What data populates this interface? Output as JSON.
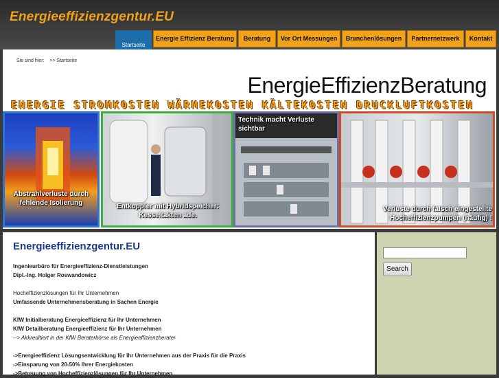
{
  "site": {
    "logo": "Energieeffizienzgentur.EU"
  },
  "nav": {
    "home": "Startseite",
    "items": [
      "Energie Effizienz Beratung",
      "Beratung",
      "Vor Ort Messungen",
      "Branchenlösungen",
      "Partnernetzwerk",
      "Kontakt"
    ]
  },
  "breadcrumb": {
    "label": "Sie sind hier:",
    "path": ">> Startseite"
  },
  "banner": {
    "title": "EnergieEffizienzBeratung",
    "subtitle": "ENERGIE STROMKOSTEN WÄRMEKOSTEN KÄLTEKOSTEN DRUCKLUFTKOSTEN",
    "panels": [
      {
        "caption": "Abstrahlverluste durch fehlende Isolierung"
      },
      {
        "caption": "Entkoppler mit Hybridspeicher: Kesseltakten ade."
      },
      {
        "caption": "Technik macht Verluste sichtbar"
      },
      {
        "caption": "Verluste durch falsch eingestellte Hocheffizienzpumpen (häufig) !"
      }
    ]
  },
  "content": {
    "title": "Energieeffizienzgentur.EU",
    "line1": "Ingenieurbüro für Energieeffizienz-Dienstleistungen",
    "line2": "Dipl.-Ing. Holger Roswandowicz",
    "line3": "Hocheffizienzlösungen für Ihr Unternehmen",
    "line4": "Umfassende Unternehmensberatung in Sachen Energie",
    "line5": "KfW Initialberatung Energieeffizienz für Ihr Unternehmen",
    "line6": "KfW Detailberatung Energieeffizienz für Ihr Unternehmen",
    "line7": "--> Akkreditiert in der KfW Beraterbörse als Energieeffizienzberater",
    "line8": "->Energieeffizienz Lösungsentwicklung für Ihr Unternehmen aus der Praxis für die Praxis",
    "line9": "->Einsparung von 20-50% Ihrer Energiekosten",
    "line10": "->Betreuung von Hocheffizienzlösungen für Ihr Unternehmen"
  },
  "sidebar": {
    "search_value": "",
    "search_button": "Search"
  }
}
